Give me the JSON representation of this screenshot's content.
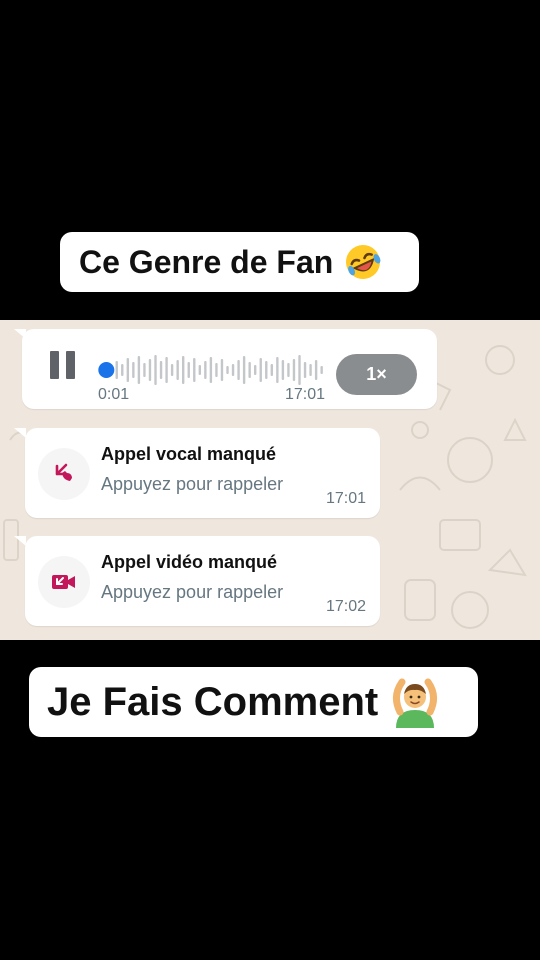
{
  "captions": {
    "top": "Ce Genre de Fan",
    "top_emoji": "rolling-on-floor-laughing-emoji",
    "bottom": "Je Fais Comment",
    "bottom_emoji": "man-gesturing-ok-emoji"
  },
  "voice_message": {
    "elapsed": "0:01",
    "timestamp": "17:01",
    "speed": "1×",
    "progress": 0.02,
    "accent_color": "#1a73e8"
  },
  "calls": [
    {
      "title": "Appel vocal manqué",
      "subtitle": "Appuyez pour rappeler",
      "time": "17:01",
      "icon": "missed-voice-call-icon"
    },
    {
      "title": "Appel vidéo manqué",
      "subtitle": "Appuyez pour rappeler",
      "time": "17:02",
      "icon": "missed-video-call-icon"
    }
  ],
  "colors": {
    "missed_call": "#c2185b",
    "chat_background": "#efe7dd"
  }
}
